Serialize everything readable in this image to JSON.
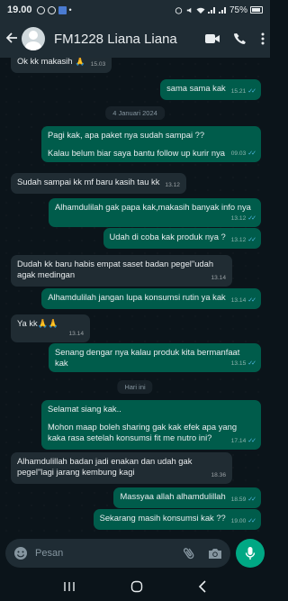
{
  "status": {
    "time": "19.00",
    "battery": "75%"
  },
  "contact": {
    "name": "FM1228 Liana Liana"
  },
  "dates": [
    "4 Januari 2024",
    "Hari ini"
  ],
  "messages": [
    {
      "dir": "in",
      "text": "Ok kk makasih 🙏",
      "time": "15.03"
    },
    {
      "dir": "out",
      "text": "sama sama kak",
      "time": "15.21"
    },
    {
      "dir": "out",
      "text": "Pagi kak, apa paket nya sudah sampai ??",
      "text2": "Kalau belum biar saya bantu follow up kurir nya",
      "time": "09.03"
    },
    {
      "dir": "in",
      "text": "Sudah sampai kk mf baru kasih tau kk",
      "time": "13.12"
    },
    {
      "dir": "out",
      "text": "Alhamdulilah gak papa kak,makasih banyak info nya",
      "time": "13.12"
    },
    {
      "dir": "out",
      "text": "Udah di coba kak produk nya ?",
      "time": "13.12"
    },
    {
      "dir": "in",
      "text": "Dudah kk baru habis empat saset badan pegel\"udah agak medingan",
      "time": "13.14"
    },
    {
      "dir": "out",
      "text": "Alhamdulilah jangan lupa konsumsi rutin ya kak",
      "time": "13.14"
    },
    {
      "dir": "in",
      "text": "Ya kk🙏🙏",
      "time": "13.14"
    },
    {
      "dir": "out",
      "text": "Senang dengar nya kalau produk kita bermanfaat kak",
      "time": "13.15"
    },
    {
      "dir": "out",
      "text": "Selamat siang kak..",
      "text2": "Mohon maap boleh sharing gak kak efek apa yang kaka rasa setelah konsumsi fit me nutro ini?",
      "time": "17.14"
    },
    {
      "dir": "in",
      "text": "Alhamdulillah badan jadi enakan dan udah gak pegel\"lagi jarang kembung kagi",
      "time": "18.36"
    },
    {
      "dir": "out",
      "text": "Massyaa allah alhamdulillah",
      "time": "18.59"
    },
    {
      "dir": "out",
      "text": "Sekarang masih konsumsi kak ??",
      "time": "19.00"
    }
  ],
  "composer": {
    "placeholder": "Pesan"
  },
  "colors": {
    "header": "#1f2c34",
    "outgoing": "#005c4b",
    "incoming": "#202c33",
    "accent": "#00a884",
    "tick": "#53bdeb"
  },
  "icons": [
    "back-arrow-icon",
    "video-call-icon",
    "phone-icon",
    "more-options-icon",
    "emoji-icon",
    "attach-icon",
    "camera-icon",
    "mic-icon"
  ]
}
